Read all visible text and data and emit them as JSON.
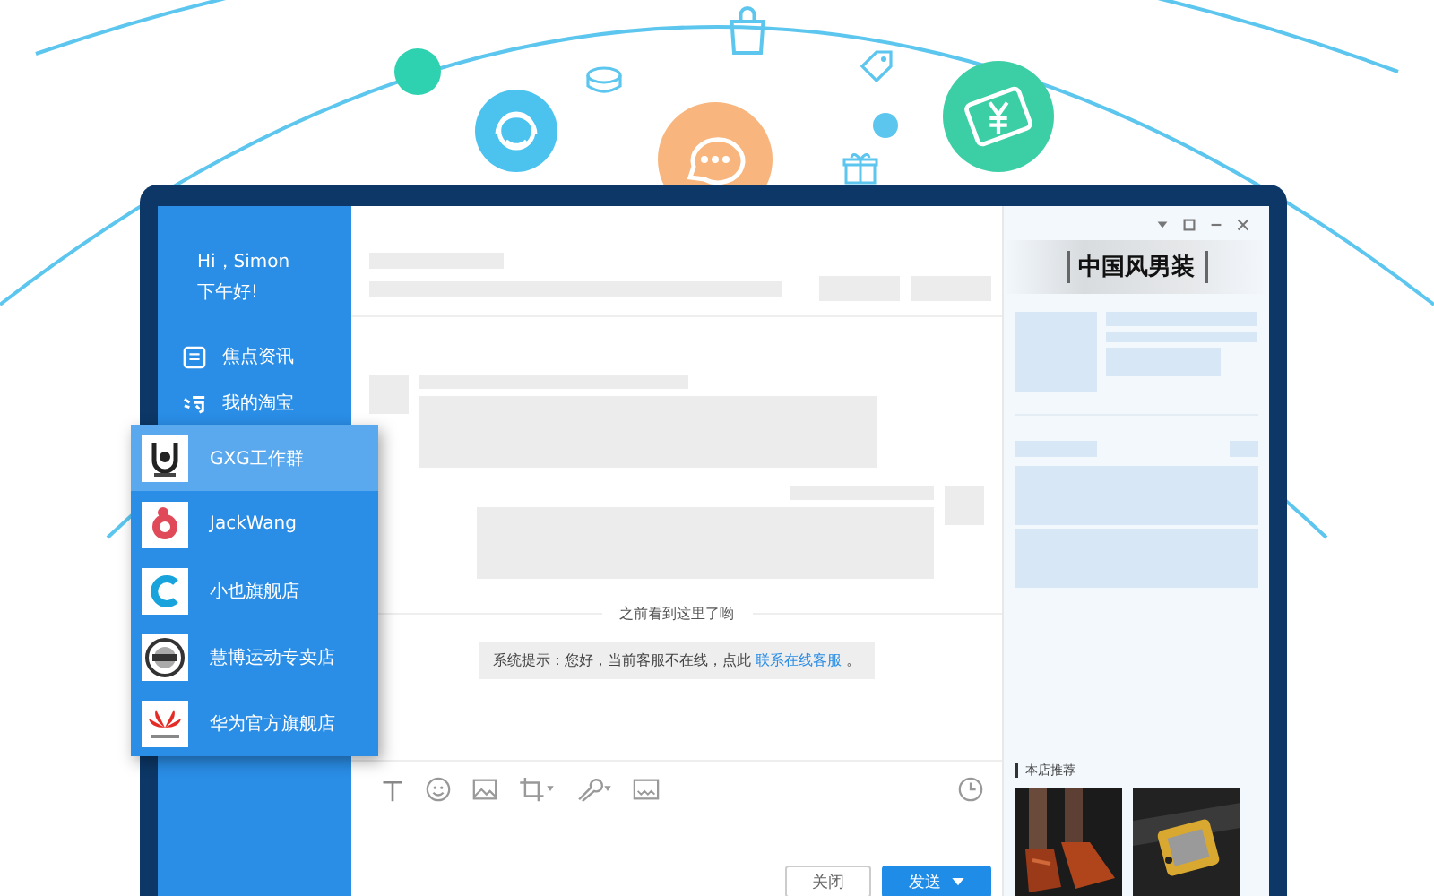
{
  "sidebar": {
    "greeting": "Hi，Simon",
    "subtitle": "下午好!",
    "items": [
      {
        "label": "焦点资讯",
        "kind": "news"
      },
      {
        "label": "我的淘宝",
        "kind": "taobao"
      }
    ]
  },
  "contacts": [
    {
      "name": "GXG工作群",
      "kind": "lock",
      "selected": true
    },
    {
      "name": "JackWang",
      "kind": "bird",
      "selected": false
    },
    {
      "name": "小也旗舰店",
      "kind": "letter",
      "selected": false
    },
    {
      "name": "慧博运动专卖店",
      "kind": "seal",
      "selected": false
    },
    {
      "name": "华为官方旗舰店",
      "kind": "flower",
      "selected": false
    }
  ],
  "chat": {
    "divider": "之前看到这里了哟",
    "notice": "系统提示：您好，当前客服不在线，点此",
    "notice_link": "联系在线客服",
    "notice_end": "。",
    "buttons": [
      {
        "label": "关闭",
        "kind": "secondary"
      },
      {
        "label": "发送",
        "kind": "primary"
      }
    ]
  },
  "store": {
    "title": "中国风男装",
    "section": "本店推荐"
  }
}
